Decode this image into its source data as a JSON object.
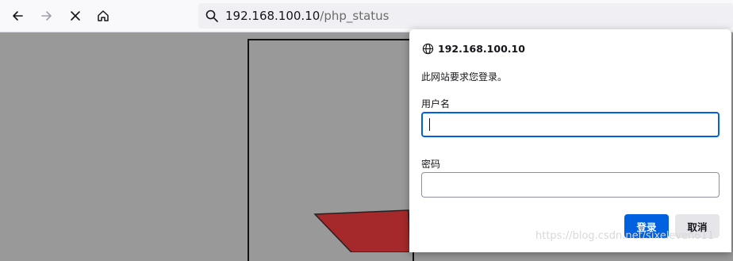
{
  "toolbar": {
    "url_host": "192.168.100.10",
    "url_path": "/php_status"
  },
  "dialog": {
    "host": "192.168.100.10",
    "message": "此网站要求您登录。",
    "username_label": "用户名",
    "username_value": "",
    "password_label": "密码",
    "password_value": "",
    "login_button": "登录",
    "cancel_button": "取消"
  },
  "watermark": "https://blog.csdn.net/sixeleven611",
  "colors": {
    "accent": "#0061e0",
    "page_background": "#999999",
    "red_shape": "#a5292a"
  }
}
